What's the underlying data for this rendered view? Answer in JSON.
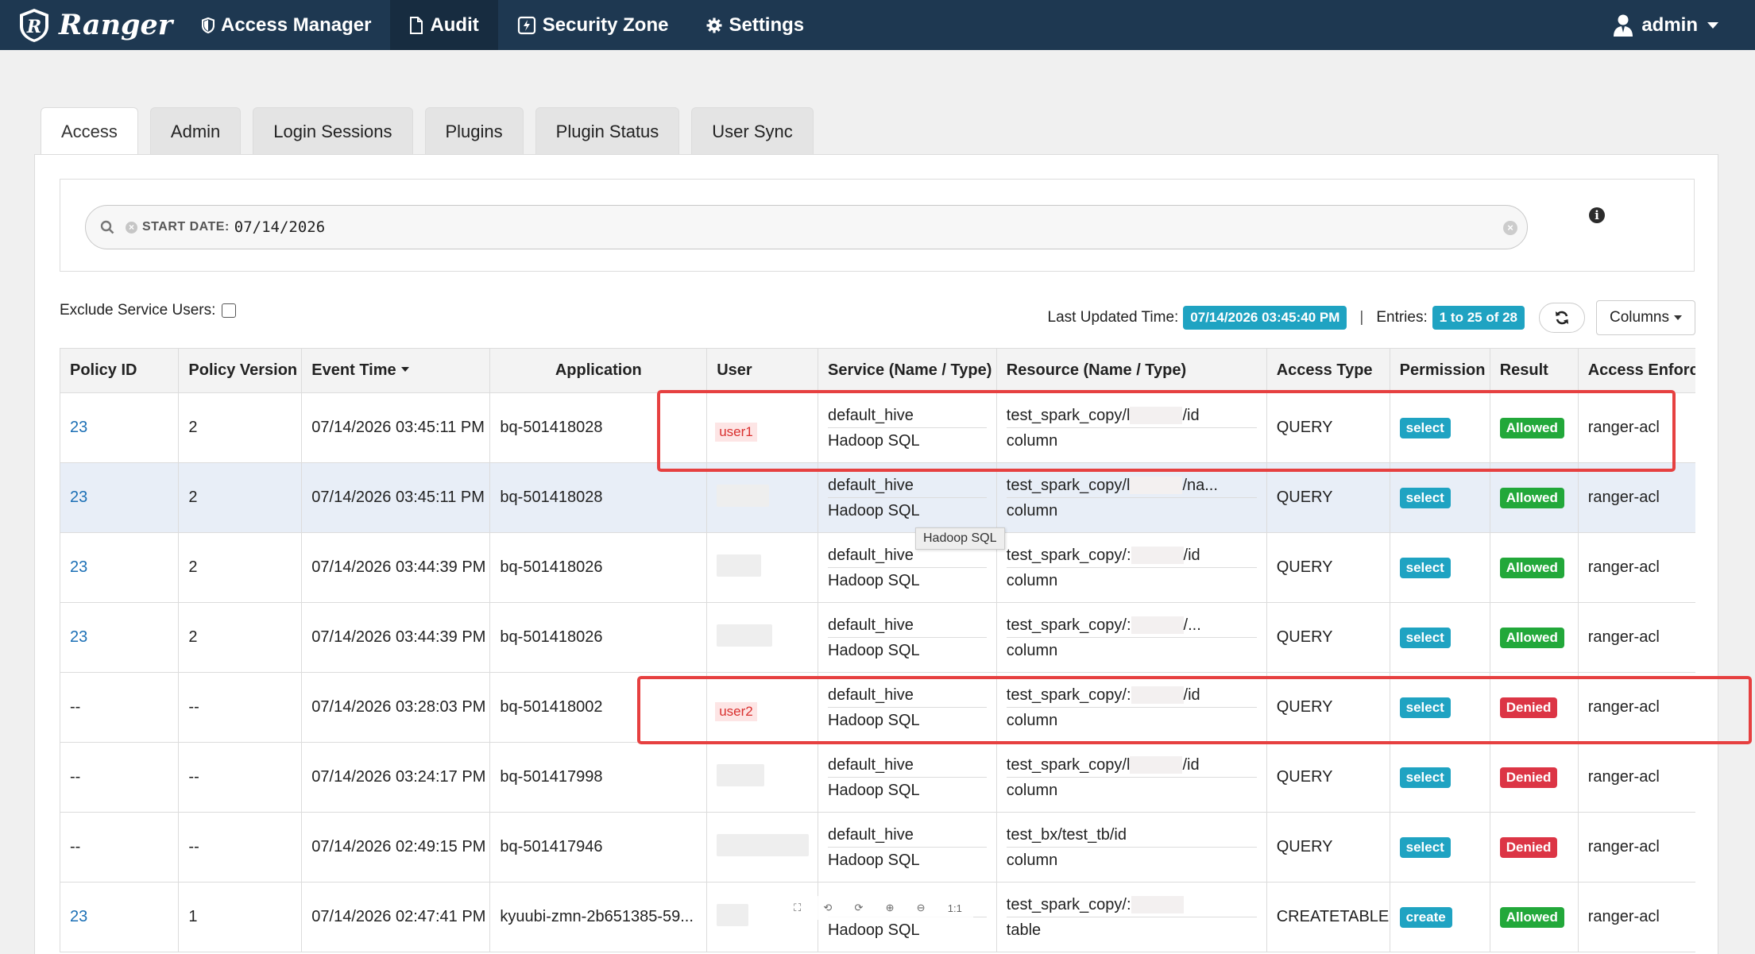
{
  "nav": {
    "brand": "Ranger",
    "items": [
      {
        "label": "Access Manager",
        "icon": "shield-icon"
      },
      {
        "label": "Audit",
        "icon": "file-icon",
        "active": true
      },
      {
        "label": "Security Zone",
        "icon": "zone-icon"
      },
      {
        "label": "Settings",
        "icon": "gear-icon"
      }
    ],
    "user": "admin"
  },
  "tabs": [
    "Access",
    "Admin",
    "Login Sessions",
    "Plugins",
    "Plugin Status",
    "User Sync"
  ],
  "search": {
    "chip_label": "START DATE:",
    "chip_value": "07/14/2026"
  },
  "exclude_label": "Exclude Service Users:",
  "meta": {
    "last_updated_label": "Last Updated Time:",
    "last_updated_value": "07/14/2026 03:45:40 PM",
    "entries_label": "Entries:",
    "entries_value": "1 to 25 of 28",
    "columns_label": "Columns"
  },
  "table": {
    "headers": [
      "Policy ID",
      "Policy Version",
      "Event Time",
      "Application",
      "User",
      "Service (Name / Type)",
      "Resource (Name / Type)",
      "Access Type",
      "Permission",
      "Result",
      "Access Enforcer"
    ],
    "rows": [
      {
        "policy_id": "23",
        "version": "2",
        "time": "07/14/2026 03:45:11 PM",
        "app": "bq-501418028",
        "user": "user1",
        "svc_name": "default_hive",
        "svc_type": "Hadoop SQL",
        "res_a": "test_spark_copy/l",
        "res_b": "/id",
        "res_type": "column",
        "access": "QUERY",
        "perm": "select",
        "result": "Allowed",
        "enforcer": "ranger-acl"
      },
      {
        "policy_id": "23",
        "version": "2",
        "time": "07/14/2026 03:45:11 PM",
        "app": "bq-501418028",
        "user": "",
        "svc_name": "default_hive",
        "svc_type": "Hadoop SQL",
        "res_a": "test_spark_copy/l",
        "res_b": "/na...",
        "res_type": "column",
        "access": "QUERY",
        "perm": "select",
        "result": "Allowed",
        "enforcer": "ranger-acl"
      },
      {
        "policy_id": "23",
        "version": "2",
        "time": "07/14/2026 03:44:39 PM",
        "app": "bq-501418026",
        "user": "",
        "svc_name": "default_hive",
        "svc_type": "Hadoop SQL",
        "res_a": "test_spark_copy/:",
        "res_b": "/id",
        "res_type": "column",
        "access": "QUERY",
        "perm": "select",
        "result": "Allowed",
        "enforcer": "ranger-acl"
      },
      {
        "policy_id": "23",
        "version": "2",
        "time": "07/14/2026 03:44:39 PM",
        "app": "bq-501418026",
        "user": "",
        "svc_name": "default_hive",
        "svc_type": "Hadoop SQL",
        "res_a": "test_spark_copy/:",
        "res_b": "/...",
        "res_type": "column",
        "access": "QUERY",
        "perm": "select",
        "result": "Allowed",
        "enforcer": "ranger-acl"
      },
      {
        "policy_id": "--",
        "version": "--",
        "time": "07/14/2026 03:28:03 PM",
        "app": "bq-501418002",
        "user": "user2",
        "svc_name": "default_hive",
        "svc_type": "Hadoop SQL",
        "res_a": "test_spark_copy/:",
        "res_b": "/id",
        "res_type": "column",
        "access": "QUERY",
        "perm": "select",
        "result": "Denied",
        "enforcer": "ranger-acl"
      },
      {
        "policy_id": "--",
        "version": "--",
        "time": "07/14/2026 03:24:17 PM",
        "app": "bq-501417998",
        "user": "",
        "svc_name": "default_hive",
        "svc_type": "Hadoop SQL",
        "res_a": "test_spark_copy/l",
        "res_b": "/id",
        "res_type": "column",
        "access": "QUERY",
        "perm": "select",
        "result": "Denied",
        "enforcer": "ranger-acl"
      },
      {
        "policy_id": "--",
        "version": "--",
        "time": "07/14/2026 02:49:15 PM",
        "app": "bq-501417946",
        "user": "",
        "svc_name": "default_hive",
        "svc_type": "Hadoop SQL",
        "res_a": "test_bx/test_tb/id",
        "res_b": "",
        "res_type": "column",
        "access": "QUERY",
        "perm": "select",
        "result": "Denied",
        "enforcer": "ranger-acl"
      },
      {
        "policy_id": "23",
        "version": "1",
        "time": "07/14/2026 02:47:41 PM",
        "app": "kyuubi-zmn-2b651385-59...",
        "user": "",
        "svc_name": "",
        "svc_type": "Hadoop SQL",
        "res_a": "test_spark_copy/:",
        "res_b": "",
        "res_type": "table",
        "access": "CREATETABLE",
        "perm": "create",
        "result": "Allowed",
        "enforcer": "ranger-acl"
      }
    ]
  },
  "tooltip": "Hadoop SQL",
  "colors": {
    "navbar": "#1e3851",
    "teal": "#1fa3c2",
    "allowed": "#22a83a",
    "denied": "#dc3545",
    "highlight": "#e64040"
  }
}
